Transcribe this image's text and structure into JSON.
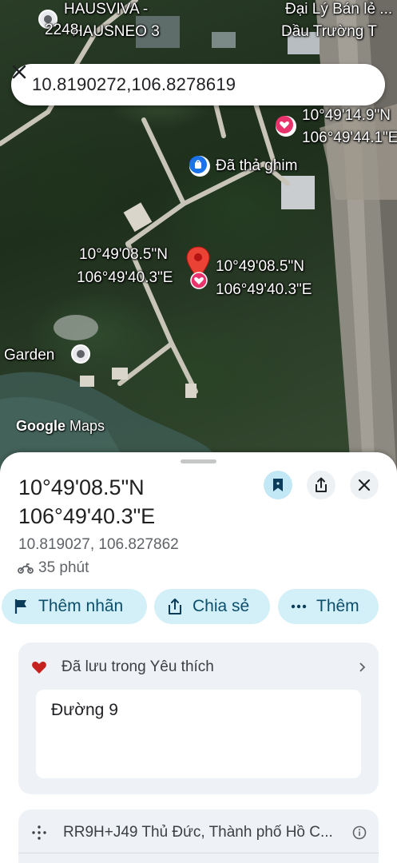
{
  "map": {
    "top_labels": {
      "left_place_line1": "HAUSVIVA -",
      "left_place_line2": "HAUSNEO 3",
      "left_number": "2248",
      "right_place_line1": "Đại Lý Bán lẻ ...",
      "right_place_line2": "Dầu Trường T"
    },
    "search": {
      "value": "10.8190272,106.8278619"
    },
    "saved_pin": {
      "lat": "10°49'14.9\"N",
      "lng": "106°49'44.1\"E"
    },
    "dropped_pin_label": "Đã thả ghim",
    "center_pin": {
      "left_lat": "10°49'08.5\"N",
      "left_lng": "106°49'40.3\"E",
      "right_lat": "10°49'08.5\"N",
      "right_lng": "106°49'40.3\"E"
    },
    "garden_label": "Garden",
    "logo_google": "Google",
    "logo_maps": "Maps"
  },
  "sheet": {
    "title_line1": "10°49'08.5\"N",
    "title_line2": "106°49'40.3\"E",
    "decimal_coords": "10.819027, 106.827862",
    "travel_time": "35 phút",
    "chips": {
      "add_label": "Thêm nhãn",
      "share": "Chia sẻ",
      "more": "Thêm"
    },
    "saved_card": {
      "label": "Đã lưu trong Yêu thích",
      "note": "Đường 9"
    },
    "plus_code_card": {
      "label": "RR9H+J49 Thủ Đức, Thành phố Hồ C..."
    }
  },
  "colors": {
    "pin_red": "#ea4335",
    "favorite_pink": "#e8336d",
    "chip_bg": "#d3eff8",
    "dropped_pin_blue": "#1a73e8"
  }
}
